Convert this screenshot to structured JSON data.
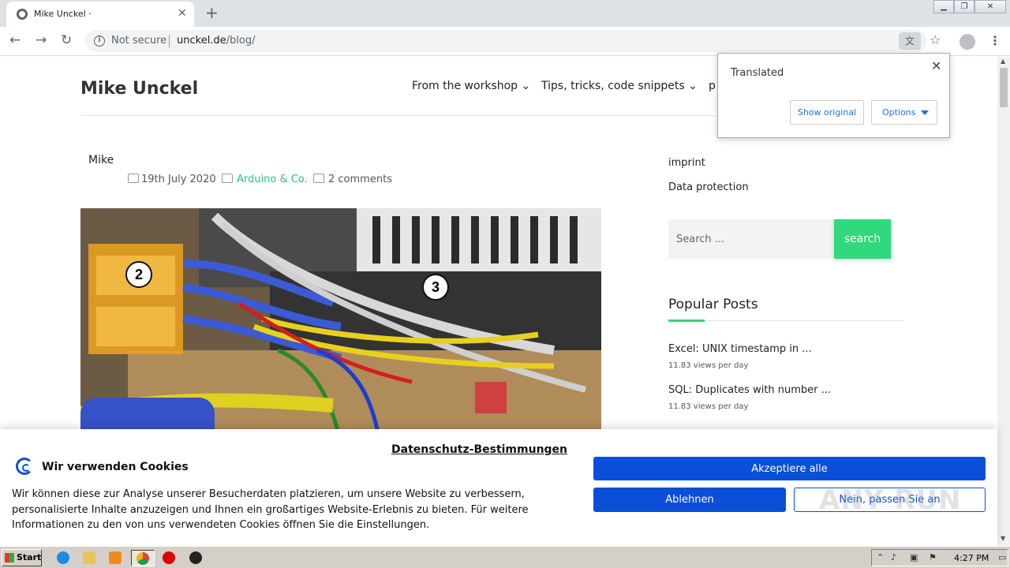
{
  "browser": {
    "tab_title": "Mike Unckel ·",
    "new_tab_symbol": "+",
    "tab_close_symbol": "✕",
    "security_label": "Not secure",
    "url_host": "unckel.de",
    "url_path": "/blog/",
    "icons": [
      "back-arrow-icon",
      "forward-arrow-icon",
      "reload-icon",
      "info-icon",
      "translate-icon",
      "star-icon",
      "profile-icon",
      "menu-dots-icon"
    ]
  },
  "translate_popup": {
    "title": "Translated",
    "close_symbol": "✕",
    "show_original": "Show original",
    "options": "Options"
  },
  "site": {
    "title": "Mike Unckel",
    "menu": [
      "From the workshop",
      "Tips, tricks, code snippets",
      "p"
    ]
  },
  "post": {
    "author": "Mike",
    "date": "19th July 2020",
    "category": "Arduino & Co.",
    "comments": "2 comments",
    "image_labels": [
      "2",
      "3"
    ]
  },
  "sidebar": {
    "imprint": "imprint",
    "privacy": "Data protection",
    "search_placeholder": "Search ...",
    "search_button": "search",
    "popular_title": "Popular Posts",
    "popular_posts": [
      {
        "title": "Excel: UNIX timestamp in ...",
        "views": "11.83 views per day"
      },
      {
        "title": "SQL: Duplicates with number ...",
        "views": "11.83 views per day"
      }
    ]
  },
  "cookie_banner": {
    "title": "Wir verwenden Cookies",
    "privacy_link": "Datenschutz-Bestimmungen",
    "text": "Wir können diese zur Analyse unserer Besucherdaten platzieren, um unsere Website zu verbessern, personalisierte Inhalte anzuzeigen und Ihnen ein großartiges Website-Erlebnis zu bieten. Für weitere Informationen zu den von uns verwendeten Cookies öffnen Sie die Einstellungen.",
    "accept_all": "Akzeptiere alle",
    "decline": "Ablehnen",
    "customize": "Nein, passen Sie an",
    "accent_color": "#0b4fd8"
  },
  "watermark": "ANY RUN",
  "taskbar": {
    "start_label": "Start",
    "clock": "4:27 PM",
    "icons": [
      "ie-icon",
      "explorer-icon",
      "media-player-icon",
      "chrome-icon",
      "opera-icon",
      "app-icon"
    ]
  },
  "colors": {
    "accent_green": "#2fd97c",
    "category_green": "#2ec27e"
  }
}
